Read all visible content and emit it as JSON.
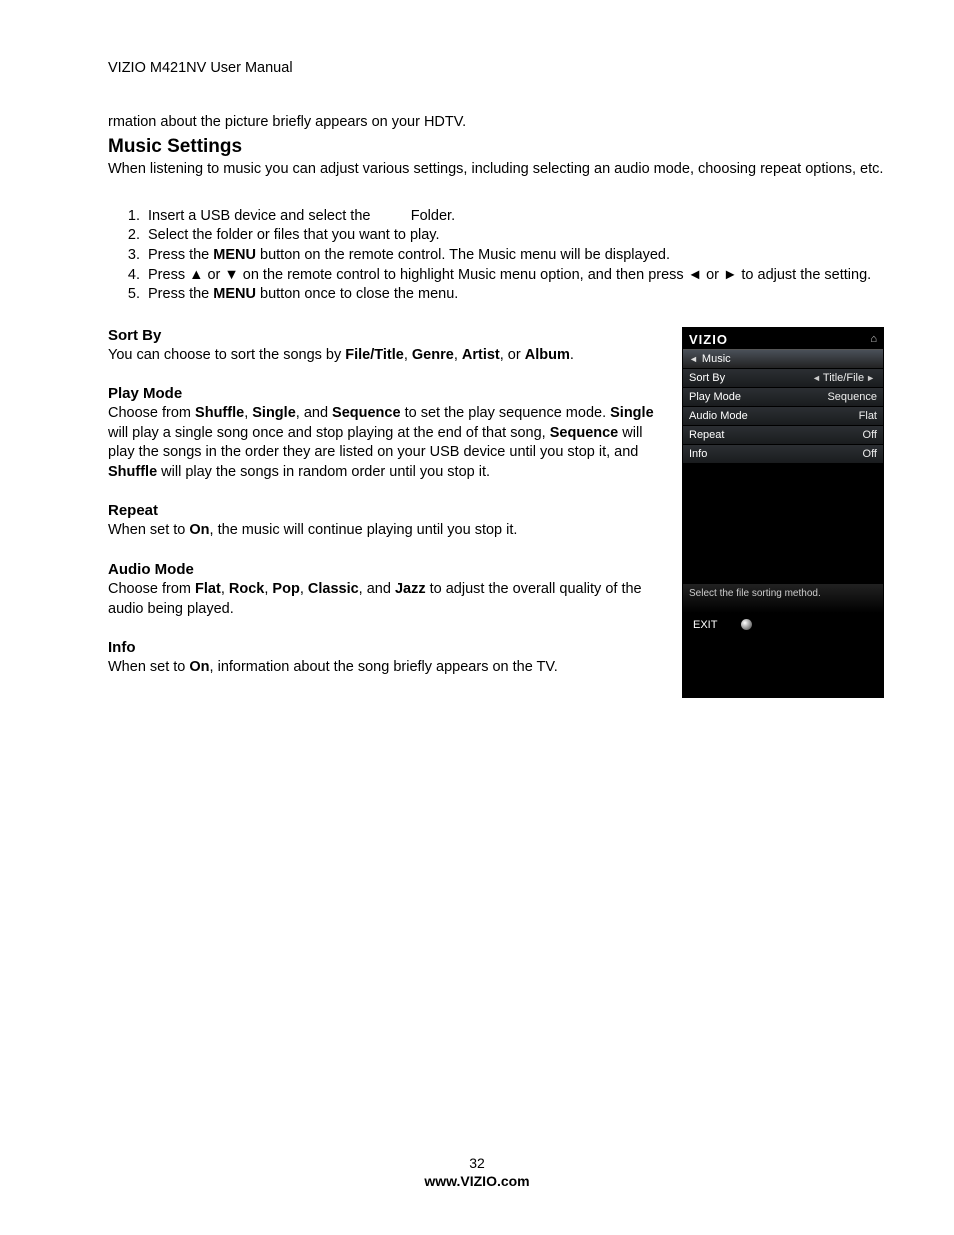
{
  "header": "VIZIO M421NV User Manual",
  "fragment": "rmation about the picture briefly appears on your HDTV.",
  "section_title": "Music Settings",
  "intro": "When listening to music you can adjust various settings, including selecting an audio mode, choosing repeat options, etc.",
  "steps": {
    "s1a": "Insert a USB device and select the ",
    "s1b": " Folder.",
    "s2": "Select the folder or files that you want to play.",
    "s3a": "Press the ",
    "s3b": "MENU",
    "s3c": " button on the remote control. The Music menu will be displayed.",
    "s4a": "Press ▲ or ▼ on the remote control to highlight Music menu option, and then press ◄ or ► to adjust the setting.",
    "s5a": "Press the ",
    "s5b": "MENU",
    "s5c": " button once to close the menu."
  },
  "subs": {
    "sortby_h": "Sort By",
    "sortby_a": "You can choose to sort the songs by ",
    "sortby_b": "File/Title",
    "sortby_c": ", ",
    "sortby_d": "Genre",
    "sortby_e": ", ",
    "sortby_f": "Artist",
    "sortby_g": ", or ",
    "sortby_h2": "Album",
    "sortby_i": ".",
    "play_h": "Play Mode",
    "play_a": "Choose from ",
    "play_b": "Shuffle",
    "play_c": ", ",
    "play_d": "Single",
    "play_e": ", and ",
    "play_f": "Sequence",
    "play_g": " to set the play sequence mode. ",
    "play_h2": "Single",
    "play_i": " will play a single song once and stop playing at the end of that song, ",
    "play_j": "Sequence",
    "play_k": " will play the songs in the order they are listed on your USB device until you stop it, and ",
    "play_l": "Shuffle",
    "play_m": " will play the songs in random order until you stop it.",
    "repeat_h": "Repeat",
    "repeat_a": "When set to ",
    "repeat_b": "On",
    "repeat_c": ", the music will continue playing until you stop it.",
    "audio_h": "Audio Mode",
    "audio_a": "Choose from ",
    "audio_b": "Flat",
    "audio_c": ", ",
    "audio_d": "Rock",
    "audio_e": ", ",
    "audio_f": "Pop",
    "audio_g": ", ",
    "audio_h2": "Classic",
    "audio_i": ", and ",
    "audio_j": "Jazz",
    "audio_k": " to adjust the overall quality of the audio being played.",
    "info_h": "Info",
    "info_a": "When set to ",
    "info_b": "On",
    "info_c": ", information about the song briefly appears on the TV."
  },
  "osd": {
    "logo": "VIZIO",
    "music": "Music",
    "rows": [
      {
        "label": "Sort By",
        "value": "Title/File",
        "arrows": true
      },
      {
        "label": "Play Mode",
        "value": "Sequence"
      },
      {
        "label": "Audio Mode",
        "value": "Flat"
      },
      {
        "label": "Repeat",
        "value": "Off"
      },
      {
        "label": "Info",
        "value": "Off"
      }
    ],
    "help": "Select the file sorting method.",
    "exit": "EXIT"
  },
  "footer": {
    "page": "32",
    "url": "www.VIZIO.com"
  }
}
